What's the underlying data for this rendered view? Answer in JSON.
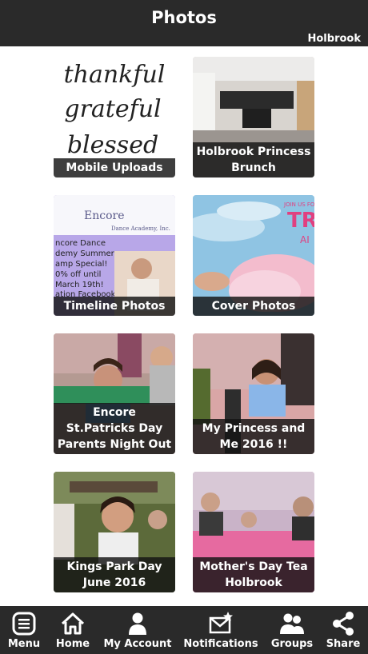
{
  "header": {
    "title": "Photos",
    "location": "Holbrook"
  },
  "albums": [
    {
      "caption": "Mobile Uploads"
    },
    {
      "caption": "Holbrook Princess Brunch"
    },
    {
      "caption": "Timeline Photos"
    },
    {
      "caption": "Cover Photos"
    },
    {
      "caption": "Encore St.Patricks Day Parents Night Out"
    },
    {
      "caption": "My Princess and Me 2016 !!"
    },
    {
      "caption": "Kings Park Day June 2016"
    },
    {
      "caption": "Mother's Day Tea Holbrook"
    }
  ],
  "tile_art": {
    "mobile_uploads_words": [
      "thankful",
      "grateful",
      "blessed"
    ],
    "timeline_logo": "Encore",
    "timeline_logo_sub": "Dance Academy, Inc.",
    "timeline_lines": [
      "ncore Dance",
      "demy Summer",
      "amp Special!",
      "0% off until",
      "March 19th!",
      "ation Facebook"
    ],
    "cover_top": "JOIN US FO",
    "cover_big": "TR",
    "cover_small": "AI"
  },
  "tabbar": {
    "items": [
      {
        "label": "Menu",
        "icon": "menu-icon"
      },
      {
        "label": "Home",
        "icon": "home-icon"
      },
      {
        "label": "My Account",
        "icon": "account-icon"
      },
      {
        "label": "Notifications",
        "icon": "notifications-icon"
      },
      {
        "label": "Groups",
        "icon": "groups-icon"
      },
      {
        "label": "Share",
        "icon": "share-icon"
      }
    ]
  }
}
